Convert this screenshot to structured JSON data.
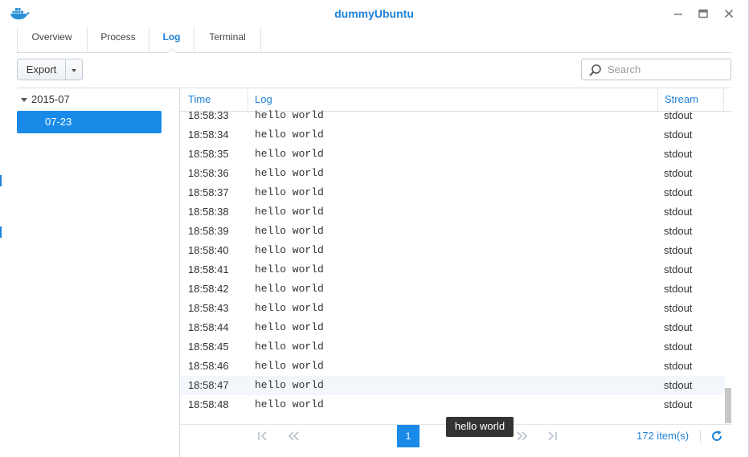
{
  "window": {
    "title": "dummyUbuntu"
  },
  "tabs": [
    {
      "label": "Overview"
    },
    {
      "label": "Process"
    },
    {
      "label": "Log"
    },
    {
      "label": "Terminal"
    }
  ],
  "toolbar": {
    "export_label": "Export",
    "search_placeholder": "Search"
  },
  "tree": {
    "month": "2015-07",
    "day": "07-23"
  },
  "columns": {
    "time": "Time",
    "log": "Log",
    "stream": "Stream"
  },
  "rows": [
    {
      "time": "18:58:33",
      "log": "hello world",
      "stream": "stdout"
    },
    {
      "time": "18:58:34",
      "log": "hello world",
      "stream": "stdout"
    },
    {
      "time": "18:58:35",
      "log": "hello world",
      "stream": "stdout"
    },
    {
      "time": "18:58:36",
      "log": "hello world",
      "stream": "stdout"
    },
    {
      "time": "18:58:37",
      "log": "hello world",
      "stream": "stdout"
    },
    {
      "time": "18:58:38",
      "log": "hello world",
      "stream": "stdout"
    },
    {
      "time": "18:58:39",
      "log": "hello world",
      "stream": "stdout"
    },
    {
      "time": "18:58:40",
      "log": "hello world",
      "stream": "stdout"
    },
    {
      "time": "18:58:41",
      "log": "hello world",
      "stream": "stdout"
    },
    {
      "time": "18:58:42",
      "log": "hello world",
      "stream": "stdout"
    },
    {
      "time": "18:58:43",
      "log": "hello world",
      "stream": "stdout"
    },
    {
      "time": "18:58:44",
      "log": "hello world",
      "stream": "stdout"
    },
    {
      "time": "18:58:45",
      "log": "hello world",
      "stream": "stdout"
    },
    {
      "time": "18:58:46",
      "log": "hello world",
      "stream": "stdout"
    },
    {
      "time": "18:58:47",
      "log": "hello world",
      "stream": "stdout"
    },
    {
      "time": "18:58:48",
      "log": "hello world",
      "stream": "stdout"
    }
  ],
  "pager": {
    "page": "1",
    "count": "172 item(s)"
  },
  "tooltip": {
    "text": "hello world"
  },
  "colors": {
    "accent": "#1f82d6",
    "selected": "#1a8ae8"
  }
}
